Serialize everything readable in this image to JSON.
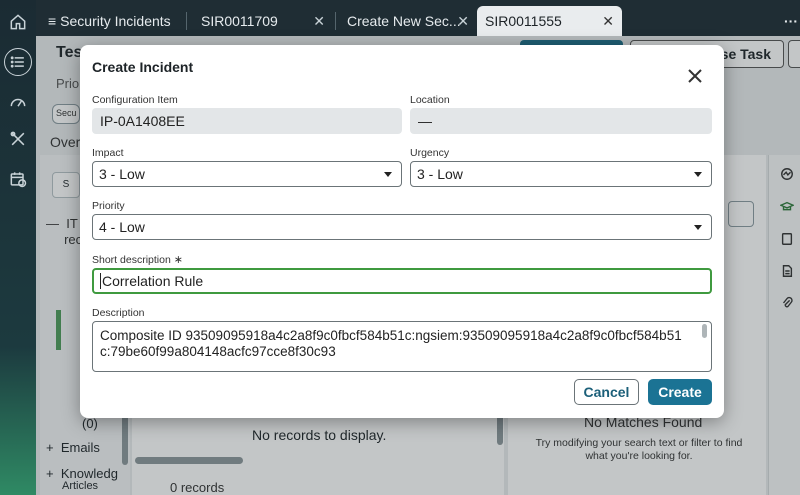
{
  "tabs": [
    {
      "label": "Security Incidents",
      "has_menu_icon": true,
      "closable": false
    },
    {
      "label": "SIR0011709",
      "closable": true
    },
    {
      "label": "Create New Sec...",
      "closable": true
    },
    {
      "label": "SIR0011555",
      "closable": true,
      "active": true
    }
  ],
  "tab_overflow_icon": "more-icon",
  "background": {
    "record_title": "Test",
    "priority_label": "Prio",
    "chip_text": "Secu",
    "overview_label": "Over",
    "primary_action": "",
    "secondary_action": "ase Task",
    "tree_item_it": "IT",
    "tree_item_it_sub": "rec",
    "count_zero": "(0)",
    "emails": "Emails",
    "knowledge": "Knowledg",
    "articles": "Articles",
    "no_records": "No records to display.",
    "zero_records": "0 records",
    "no_matches_title": "No Matches Found",
    "no_matches_hint": "Try modifying your search text or filter to find what you're looking for.",
    "plus_emails": "+",
    "plus_knowledge": "+",
    "minus_it": "—",
    "chip2": "S"
  },
  "modal": {
    "title": "Create Incident",
    "fields": {
      "configuration_item": {
        "label": "Configuration Item",
        "value": "IP-0A1408EE"
      },
      "location": {
        "label": "Location",
        "value": "—"
      },
      "impact": {
        "label": "Impact",
        "value": "3 - Low"
      },
      "urgency": {
        "label": "Urgency",
        "value": "3 - Low"
      },
      "priority": {
        "label": "Priority",
        "value": "4 - Low"
      },
      "short_description": {
        "label": "Short description",
        "required_mark": "∗",
        "value": "Correlation Rule"
      },
      "description": {
        "label": "Description",
        "value": "Composite ID 93509095918a4c2a8f9c0fbcf584b51c:ngsiem:93509095918a4c2a8f9c0fbcf584b51c:79be60f99a804148acfc97cce8f30c93"
      }
    },
    "buttons": {
      "cancel": "Cancel",
      "create": "Create"
    }
  },
  "colors": {
    "primary": "#1b7394",
    "focus_green": "#3f9a3f",
    "rail_dark": "#1b2b33"
  }
}
